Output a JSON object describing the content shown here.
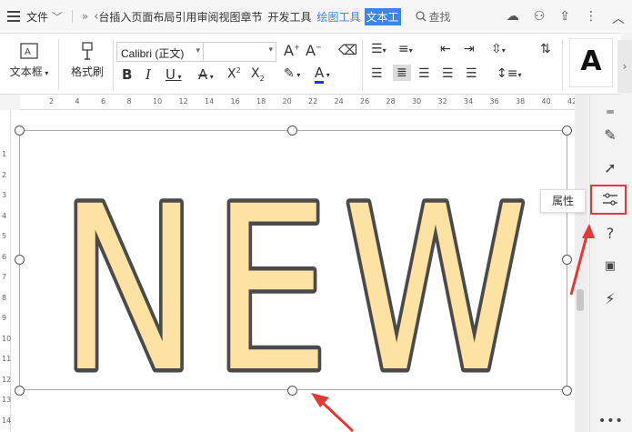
{
  "menubar": {
    "file_label": "文件",
    "tabs": [
      "台插入",
      "页面布局",
      "引用",
      "审阅",
      "视图",
      "章节",
      "开发工具"
    ],
    "context_tab": "绘图工具",
    "active_tab": "文本工",
    "search_label": "查找"
  },
  "ribbon": {
    "textbox_label": "文本框",
    "format_painter_label": "格式刷",
    "font_name": "Calibri (正文)",
    "font_size": "",
    "style_preview": "A"
  },
  "hruler": {
    "ticks": [
      "2",
      "4",
      "6",
      "8",
      "10",
      "12",
      "14",
      "16",
      "18",
      "20",
      "22",
      "24",
      "26",
      "28",
      "30",
      "32",
      "34",
      "36",
      "38",
      "40",
      "42"
    ]
  },
  "vruler": {
    "ticks": [
      "1",
      "2",
      "3",
      "4",
      "5",
      "6",
      "7",
      "8",
      "9",
      "10",
      "11",
      "12",
      "13",
      "14"
    ]
  },
  "document": {
    "art_text": "NEW"
  },
  "sidebar": {
    "tooltip": "属性"
  },
  "colors": {
    "accent": "#3d86e9",
    "letter_fill": "#fde2a4",
    "letter_outline": "#4a4a4a",
    "annotation_red": "#e53935"
  }
}
